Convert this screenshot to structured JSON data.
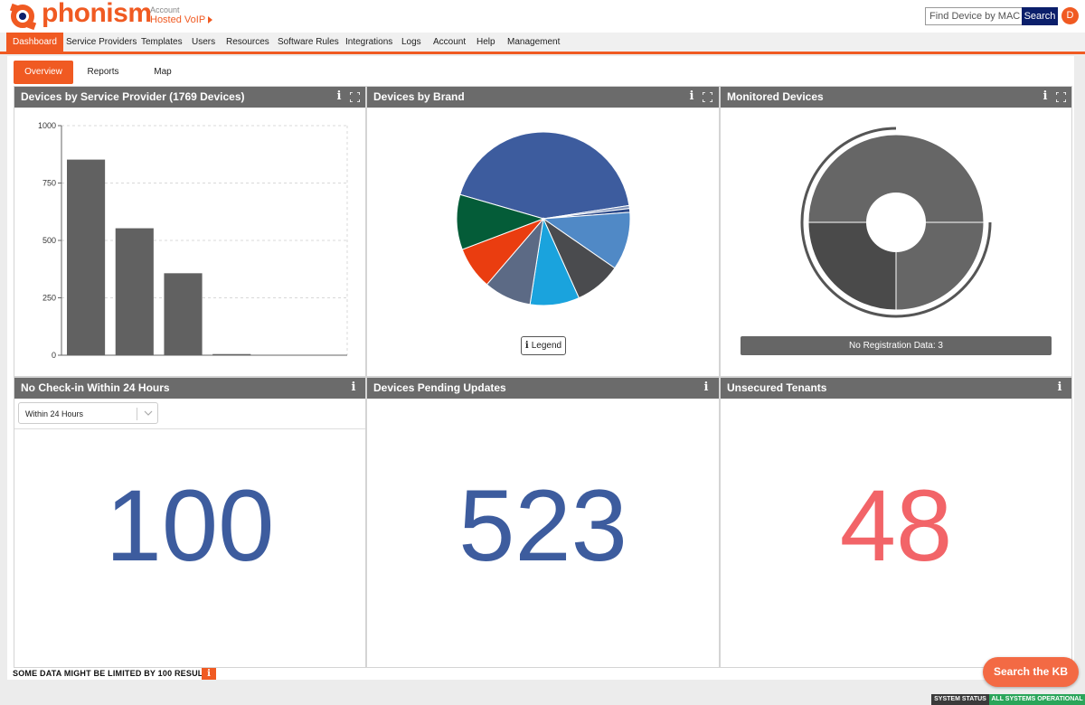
{
  "header": {
    "brand": "phonism",
    "account_label": "Account",
    "account_name": "Hosted VoIP",
    "mac_search": {
      "placeholder": "Find Device by MAC",
      "button_label": "Search"
    },
    "user_initial": "D"
  },
  "nav": {
    "items": [
      {
        "label": "Dashboard",
        "active": true
      },
      {
        "label": "Service Providers"
      },
      {
        "label": "Templates"
      },
      {
        "label": "Users"
      },
      {
        "label": "Resources"
      },
      {
        "label": "Software Rules"
      },
      {
        "label": "Integrations"
      },
      {
        "label": "Logs"
      },
      {
        "label": "Account"
      },
      {
        "label": "Help"
      },
      {
        "label": "Management"
      }
    ]
  },
  "subtabs": [
    {
      "label": "Overview",
      "active": true
    },
    {
      "label": "Reports"
    },
    {
      "label": "Map"
    }
  ],
  "panels": {
    "service_provider": {
      "title": "Devices by Service Provider (1769 Devices)"
    },
    "brand": {
      "title": "Devices by Brand",
      "legend_label": "Legend"
    },
    "monitored": {
      "title": "Monitored Devices",
      "no_registration": "No Registration Data: 3"
    },
    "no_checkin": {
      "title": "No Check-in Within 24 Hours",
      "select_value": "Within 24 Hours",
      "value": "100"
    },
    "pending_updates": {
      "title": "Devices Pending Updates",
      "value": "523"
    },
    "unsecured": {
      "title": "Unsecured Tenants",
      "value": "48"
    }
  },
  "chart_data": [
    {
      "type": "bar",
      "categories": [
        "",
        "",
        "",
        ""
      ],
      "values": [
        852,
        553,
        357,
        5
      ],
      "yticks": [
        "0",
        "250",
        "500",
        "750",
        "1000"
      ],
      "ylim": [
        0,
        1000
      ],
      "grid": true,
      "color": "#616161"
    },
    {
      "type": "pie",
      "values": [
        47.8,
        0.6,
        0.8,
        12.0,
        9.6,
        10.2,
        9.8,
        8.8,
        11.4
      ],
      "colors": [
        "#3d5c9e",
        "#7a8fb8",
        "#2d4a8a",
        "#5089c6",
        "#4a4b4e",
        "#1aa3dd",
        "#5c6a85",
        "#ea3d10",
        "#045c38"
      ]
    },
    {
      "type": "pie",
      "values": [
        25,
        25,
        50
      ],
      "colors": [
        "#666666",
        "#4a4a4a",
        "#666666"
      ],
      "monitored_fraction": 0.75
    }
  ],
  "footer": {
    "note": "SOME DATA MIGHT BE LIMITED BY 100 RESULTS",
    "kb_button": "Search the KB",
    "status_label": "SYSTEM STATUS",
    "status_value": "ALL SYSTEMS OPERATIONAL"
  },
  "colors": {
    "accent": "#f05a22",
    "panel_header": "#6b6b6b",
    "big_number_blue": "#3d5c9e",
    "big_number_red": "#f26468",
    "status_ok": "#2aa55a"
  }
}
